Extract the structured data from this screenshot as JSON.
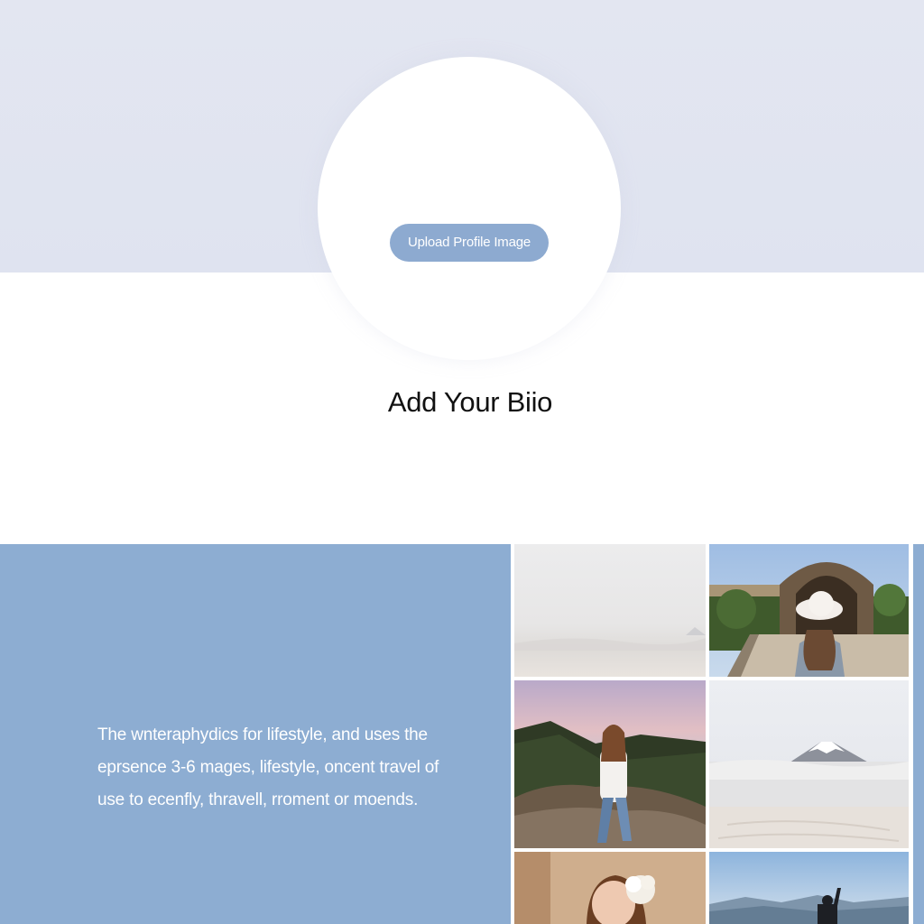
{
  "header": {
    "upload_button_label": "Upload Profile Image"
  },
  "bio": {
    "heading": "Add Your Biio",
    "lines": [
      "The wnteraphydics for lifestyle, and uses the",
      "eprsence 3-6 mages, lifestyle, oncent travel of",
      "use to ecenfly, thravell, rroment or moends."
    ]
  },
  "gallery": {
    "tiles": [
      {
        "subject": "misty-horizon-photo"
      },
      {
        "subject": "woman-white-hat-archway-photo"
      },
      {
        "subject": "woman-sitting-on-rock-sunset-photo"
      },
      {
        "subject": "mount-fuji-above-clouds-photo"
      },
      {
        "subject": "woman-holding-flowers-photo"
      },
      {
        "subject": "person-waving-on-mountain-photo"
      }
    ]
  },
  "colors": {
    "hero_background": "#e0e4f0",
    "accent": "#8dadd2",
    "button": "#8daad0"
  }
}
